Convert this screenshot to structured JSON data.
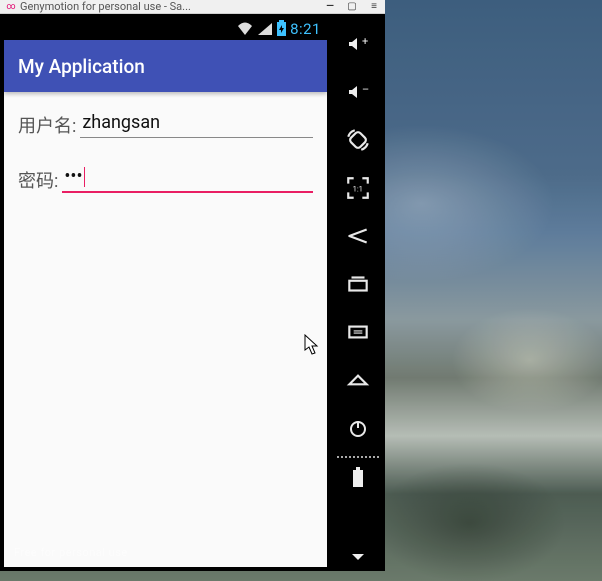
{
  "host_window": {
    "title": "Genymotion for personal use - Sa..."
  },
  "status_bar": {
    "clock": "8:21"
  },
  "app": {
    "title": "My Application",
    "form": {
      "username_label": "用户名:",
      "username_value": "zhangsan",
      "password_label": "密码:",
      "password_masked": "•••"
    },
    "watermark": "Free for personal use"
  },
  "sidebar_icons": [
    "volume-up",
    "volume-down",
    "rotate",
    "pixel-1to1",
    "back",
    "recent",
    "menu",
    "home",
    "power",
    "battery"
  ]
}
